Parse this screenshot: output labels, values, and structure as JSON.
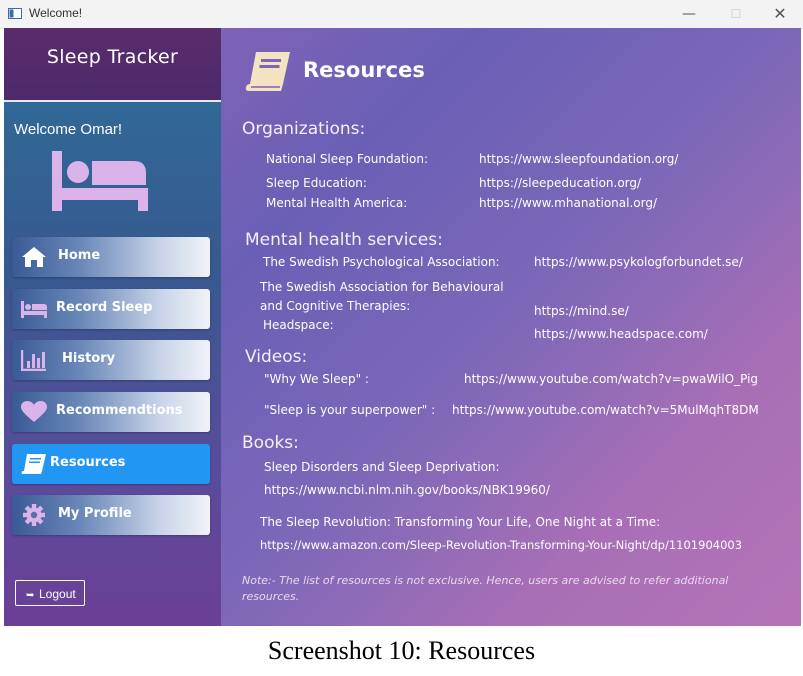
{
  "window": {
    "title": "Welcome!",
    "controls": {
      "minimize": "—",
      "maximize": "☐",
      "close": "✕"
    }
  },
  "sidebar": {
    "app_name": "Sleep Tracker",
    "welcome": "Welcome Omar!",
    "items": [
      {
        "label": "Home",
        "icon": "home-icon"
      },
      {
        "label": "Record Sleep",
        "icon": "bed-icon"
      },
      {
        "label": "History",
        "icon": "bar-chart-icon"
      },
      {
        "label": "Recommendtions",
        "icon": "heart-icon"
      },
      {
        "label": "Resources",
        "icon": "book-icon",
        "active": true
      },
      {
        "label": "My Profile",
        "icon": "gear-icon"
      }
    ],
    "logout": "Logout"
  },
  "main": {
    "title": "Resources",
    "organizations": {
      "heading": "Organizations:",
      "rows": [
        {
          "name": "National Sleep Foundation:",
          "url": "https://www.sleepfoundation.org/"
        },
        {
          "name": "Sleep Education:",
          "url": "https://sleepeducation.org/"
        },
        {
          "name": "Mental Health America:",
          "url": "https://www.mhanational.org/"
        }
      ]
    },
    "mental_health": {
      "heading": "Mental health services:",
      "rows": [
        {
          "name": "The Swedish Psychological Association:",
          "url": "https://www.psykologforbundet.se/"
        },
        {
          "name_line1": "The Swedish Association for Behavioural",
          "name_line2": "and Cognitive Therapies:",
          "url": "https://mind.se/"
        },
        {
          "name": "Headspace:",
          "url": "https://www.headspace.com/"
        }
      ]
    },
    "videos": {
      "heading": "Videos:",
      "rows": [
        {
          "name": "\"Why We Sleep\" :",
          "url": "https://www.youtube.com/watch?v=pwaWilO_Pig"
        },
        {
          "name": "\"Sleep is your superpower\" :",
          "url": "https://www.youtube.com/watch?v=5MulMqhT8DM"
        }
      ]
    },
    "books": {
      "heading": "Books:",
      "rows": [
        {
          "name": "Sleep Disorders and Sleep Deprivation:",
          "url": "https://www.ncbi.nlm.nih.gov/books/NBK19960/"
        },
        {
          "name": "The Sleep Revolution: Transforming Your Life, One Night at a Time:",
          "url": "https://www.amazon.com/Sleep-Revolution-Transforming-Your-Night/dp/1101904003"
        }
      ]
    },
    "note": "Note:- The list of resources is not exclusive. Hence, users are advised to refer additional resources."
  },
  "caption": "Screenshot 10: Resources",
  "colors": {
    "active_nav": "#2196f3",
    "icon_lilac": "#d9b3ea",
    "book_cream": "#f4e3c0"
  }
}
